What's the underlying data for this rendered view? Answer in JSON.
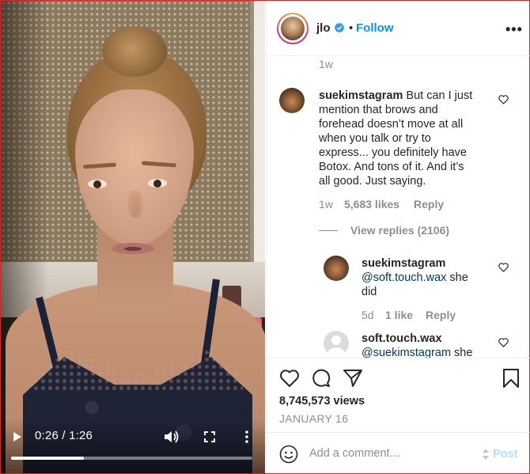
{
  "video": {
    "time_display": "0:26 / 1:26",
    "progress_fraction": 0.302
  },
  "header": {
    "username": "jlo",
    "separator": "•",
    "follow_label": "Follow",
    "options_label": "•••"
  },
  "comments": {
    "top_time": "1w",
    "main": {
      "username": "suekimstagram",
      "text": "But can I just mention that brows and forehead doesn’t move at all when you talk or try to express... you definitely have Botox. And tons of it. And it’s all good. Just saying.",
      "line1": "But can I just",
      "line2": "mention that brows and",
      "line3": "forehead doesn’t move at all",
      "line4": "when you talk or try to",
      "line5": "express... you definitely have",
      "line6": "Botox. And tons of it. And it’s",
      "line7": "all good. Just saying.",
      "time": "1w",
      "likes": "5,683 likes",
      "reply_label": "Reply"
    },
    "view_replies": "View replies (2106)",
    "replies": [
      {
        "username": "suekimstagram",
        "mention": "@soft.touch.wax",
        "text_after": " she",
        "line2": "did",
        "time": "5d",
        "likes": "1 like",
        "reply_label": "Reply"
      },
      {
        "username": "soft.touch.wax",
        "mention": "@suekimstagram",
        "text_after": " she"
      }
    ]
  },
  "actions": {
    "views": "8,745,573 views",
    "date": "JANUARY 16"
  },
  "add_comment": {
    "placeholder": "Add a comment…",
    "post_label": "Post"
  },
  "colors": {
    "link_blue": "#0095f6",
    "post_disabled": "#b2dffc",
    "frame_red": "#d62728"
  },
  "icons": [
    "play-icon",
    "volume-icon",
    "fullscreen-icon",
    "more-vertical-icon",
    "verified-badge-icon",
    "heart-icon",
    "comment-icon",
    "share-icon",
    "bookmark-icon",
    "emoji-icon"
  ]
}
